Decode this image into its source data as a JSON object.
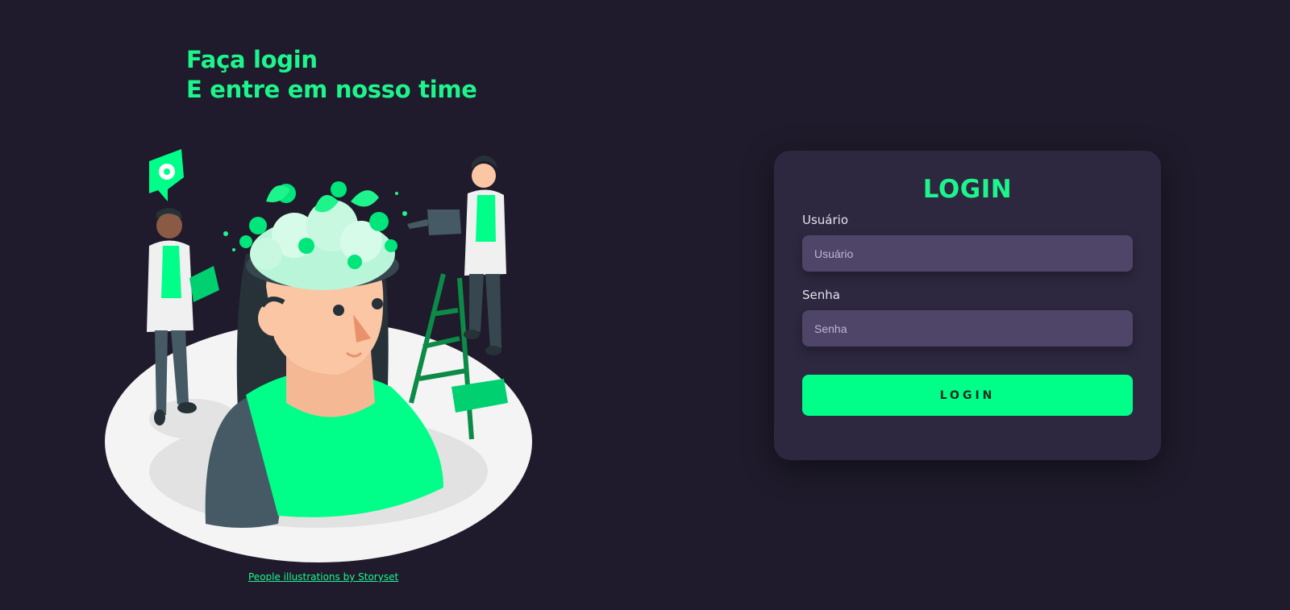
{
  "theme": {
    "background": "#1f1b2c",
    "accent": "#1df58c",
    "accent_strong": "#00ff88",
    "card": "#2d283f",
    "input": "#4f4568"
  },
  "hero": {
    "line1": "Faça login",
    "line2": "E entre em nosso time"
  },
  "illustration": {
    "icon": "team-growth-illustration",
    "credit_link": "People illustrations by Storyset"
  },
  "login_card": {
    "title": "LOGIN",
    "username": {
      "label": "Usuário",
      "placeholder": "Usuário",
      "value": ""
    },
    "password": {
      "label": "Senha",
      "placeholder": "Senha",
      "value": ""
    },
    "submit_label": "LOGIN"
  }
}
